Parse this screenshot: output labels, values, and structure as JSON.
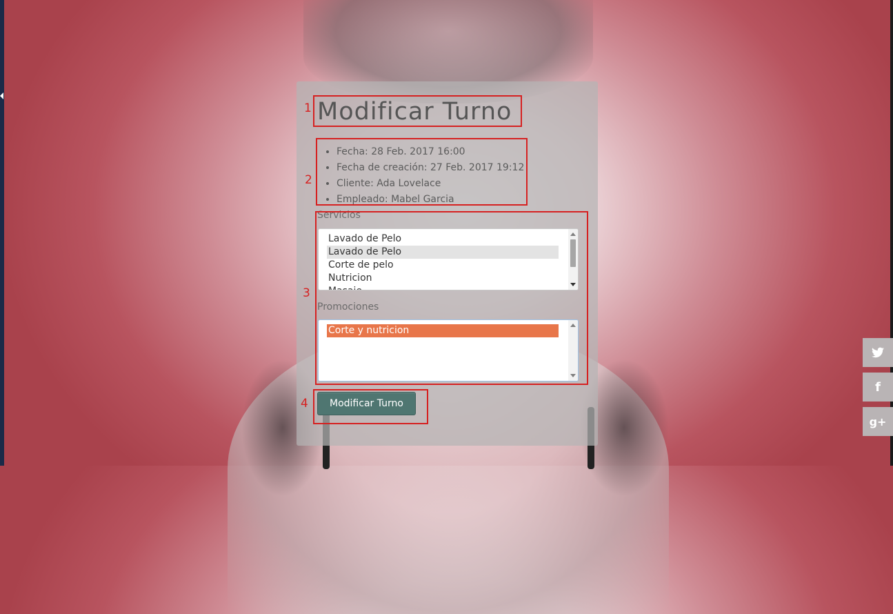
{
  "form": {
    "title": "Modificar Turno",
    "info": [
      "Fecha: 28 Feb. 2017 16:00",
      "Fecha de creación: 27 Feb. 2017 19:12",
      "Cliente: Ada Lovelace",
      "Empleado: Mabel Garcia"
    ],
    "servicios": {
      "label": "Servicios",
      "options": [
        "Lavado de Pelo",
        "Lavado de Pelo",
        "Corte de pelo",
        "Nutricion",
        "Masaje"
      ],
      "selected_index": 1
    },
    "promociones": {
      "label": "Promociones",
      "options": [
        "Corte y nutricion"
      ],
      "selected_index": 0
    },
    "submit_label": "Modificar Turno"
  },
  "annotations": [
    "1",
    "2",
    "3",
    "4"
  ],
  "social": {
    "twitter": "twitter-icon",
    "facebook": "facebook-icon",
    "googleplus": "google-plus-icon",
    "facebook_glyph": "f",
    "googleplus_glyph": "g+"
  },
  "colors": {
    "button": "#4f7671",
    "selected_promo": "#e8764a",
    "annotation": "#d62020"
  }
}
